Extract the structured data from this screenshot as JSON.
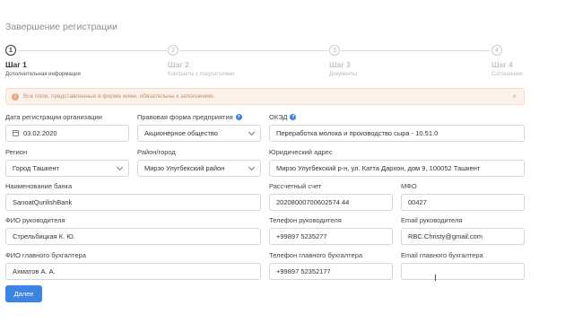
{
  "page": {
    "title": "Завершение регистрации"
  },
  "stepper": {
    "steps": [
      {
        "number": "1",
        "title": "Шаг 1",
        "subtitle": "Дополнительная информация"
      },
      {
        "number": "2",
        "title": "Шаг 2",
        "subtitle": "Контракты с покупателями"
      },
      {
        "number": "3",
        "title": "Шаг 3",
        "subtitle": "Документы"
      },
      {
        "number": "4",
        "title": "Шаг 4",
        "subtitle": "Соглашение"
      }
    ],
    "active_step": 1
  },
  "alert": {
    "text": "Все поля, представленные в форме ниже, обязательны к заполнению.",
    "close_glyph": "×"
  },
  "form": {
    "reg_date": {
      "label": "Дата регистрации организации",
      "value": "03.02.2020"
    },
    "legal_form": {
      "label": "Правовая форма предприятия",
      "value": "Акционерное общество"
    },
    "okved": {
      "label": "ОКЭД",
      "value": "Переработка молока и производство сыра  - 10.51.0"
    },
    "region": {
      "label": "Регион",
      "value": "Город Ташкент"
    },
    "district": {
      "label": "Район/город",
      "value": "Мирзо Улугбекский район"
    },
    "legal_address": {
      "label": "Юридический адрес",
      "value": "Мирзо Улугбекский р-н, ул. Катта Дархон, дом 9, 100052 Ташкент"
    },
    "bank_name": {
      "label": "Наименование банка",
      "value": "SanoatQurilishBank"
    },
    "account": {
      "label": "Рассчетный счет",
      "value": "20208000700602574 44"
    },
    "mfo": {
      "label": "МФО",
      "value": "00427"
    },
    "director_name": {
      "label": "ФИО руководителя",
      "value": "Стрельбицкая К. Ю."
    },
    "director_phone": {
      "label": "Телефон руководителя",
      "value": "+99897 5235277"
    },
    "director_email": {
      "label": "Email руководителя",
      "value": "RBC.Christy@gmail.com"
    },
    "accountant_name": {
      "label": "ФИО главного бухгалтера",
      "value": "Ахматов А. А."
    },
    "accountant_phone": {
      "label": "Телефон главного бухгалтера",
      "value": "+99897 52352177"
    },
    "accountant_email": {
      "label": "Email главного бухгалтера",
      "value": ""
    }
  },
  "submit": {
    "label": "Далее"
  },
  "colors": {
    "primary": "#3b84e6",
    "alert_bg": "#fdf1ea",
    "alert_text": "#c58b6d",
    "help_icon": "#3b7ddd"
  }
}
